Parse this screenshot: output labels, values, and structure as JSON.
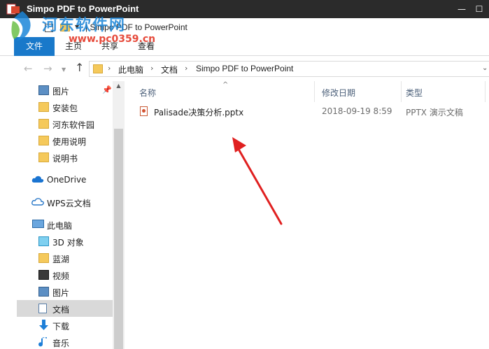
{
  "window": {
    "title": "Simpo PDF to PowerPoint",
    "minimize_glyph": "—",
    "maximize_glyph": "☐"
  },
  "quick_access": {
    "title": "Simpo PDF to PowerPoint",
    "separator": "|",
    "dropdown_glyph": "▼"
  },
  "ribbon": {
    "tabs": [
      "文件",
      "主页",
      "共享",
      "查看"
    ],
    "active_tab": "文件",
    "active_color": "#1979ca"
  },
  "address_bar": {
    "breadcrumb": [
      "此电脑",
      "文档",
      "Simpo PDF to PowerPoint"
    ],
    "separator": "›",
    "back_glyph": "←",
    "forward_glyph": "→",
    "recent_glyph": "▼",
    "up_glyph": "↑",
    "dropdown_glyph": "⌄"
  },
  "nav_pane": {
    "quick_access_items": [
      {
        "label": "图片",
        "icon": "pictures-icon",
        "pinned": true
      },
      {
        "label": "安装包",
        "icon": "folder-icon"
      },
      {
        "label": "河东软件园",
        "icon": "folder-icon"
      },
      {
        "label": "使用说明",
        "icon": "folder-icon"
      },
      {
        "label": "说明书",
        "icon": "folder-icon"
      }
    ],
    "onedrive": {
      "label": "OneDrive",
      "icon": "cloud-icon"
    },
    "wps": {
      "label": "WPS云文档",
      "icon": "cloud-icon"
    },
    "this_pc": {
      "label": "此电脑",
      "icon": "computer-icon"
    },
    "pc_items": [
      {
        "label": "3D 对象",
        "icon": "3d-objects-icon"
      },
      {
        "label": "蓝湖",
        "icon": "folder-icon"
      },
      {
        "label": "视频",
        "icon": "video-icon"
      },
      {
        "label": "图片",
        "icon": "pictures-icon"
      },
      {
        "label": "文档",
        "icon": "documents-icon",
        "selected": true
      },
      {
        "label": "下载",
        "icon": "download-icon"
      },
      {
        "label": "音乐",
        "icon": "music-icon"
      }
    ],
    "pin_glyph": "📌",
    "scroll_up_glyph": "▲"
  },
  "file_list": {
    "sort_glyph": "^",
    "columns": [
      "名称",
      "修改日期",
      "类型"
    ],
    "rows": [
      {
        "name": "Palisade决策分析.pptx",
        "modified": "2018-09-19 8:59",
        "type": "PPTX 演示文稿",
        "icon": "powerpoint-file-icon"
      }
    ]
  },
  "annotation": {
    "color": "#e02020"
  },
  "watermark": {
    "main": "河东软件网",
    "url": "www.pc0359.cn"
  }
}
